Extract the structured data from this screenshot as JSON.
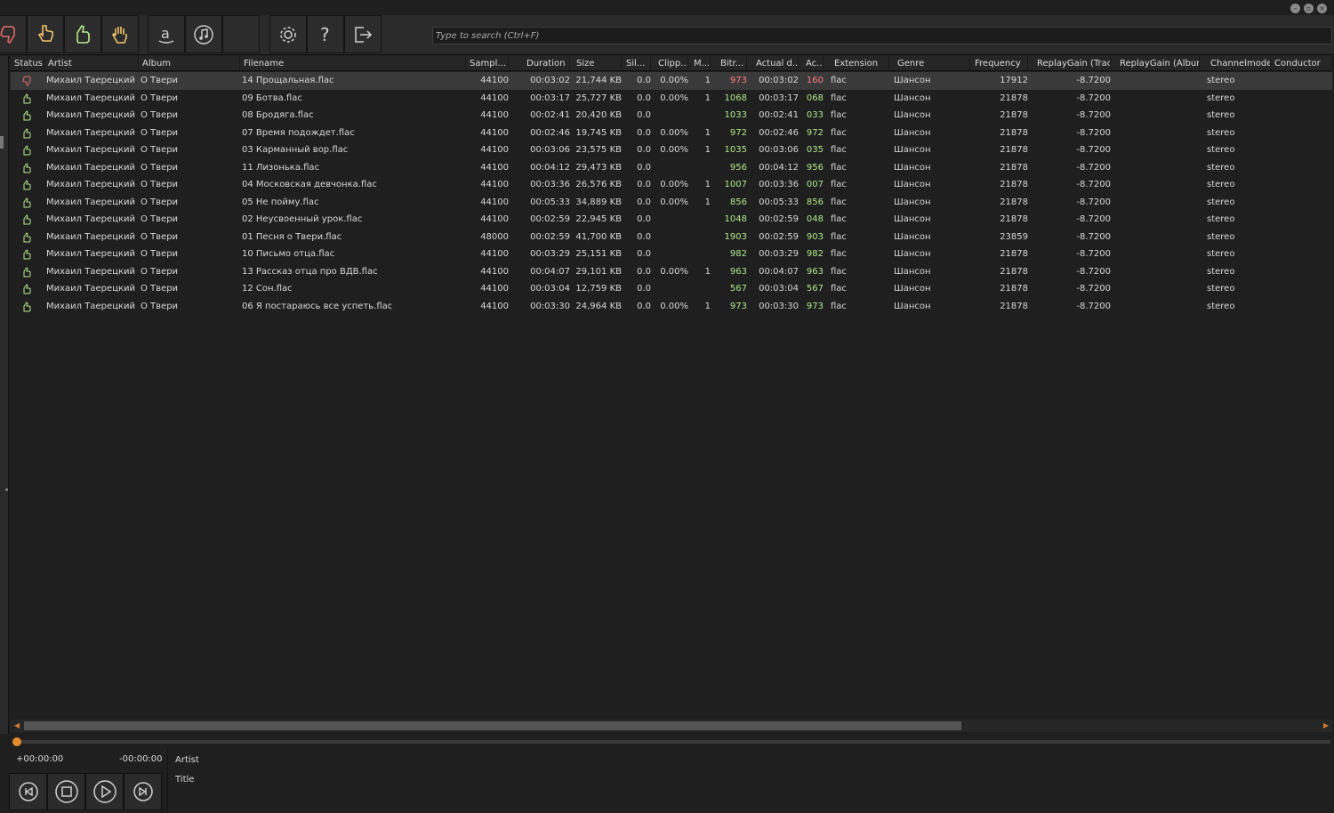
{
  "window": {
    "controls": [
      "minimize",
      "restore",
      "close"
    ]
  },
  "toolbar": {
    "groups": [
      [
        {
          "name": "thumbs-down-icon",
          "color": "#e26a6a"
        },
        {
          "name": "pointing-hand-icon",
          "color": "#f0c36a"
        },
        {
          "name": "thumbs-up-icon",
          "color": "#b8ea8e"
        },
        {
          "name": "raised-hand-icon",
          "color": "#f0c36a"
        }
      ],
      [
        {
          "name": "amazon-icon",
          "color": "#d0d0d0"
        },
        {
          "name": "music-note-icon",
          "color": "#d0d0d0"
        },
        {
          "name": "blank-icon",
          "color": "#d0d0d0"
        }
      ],
      [
        {
          "name": "gear-icon",
          "color": "#d0d0d0"
        },
        {
          "name": "help-icon",
          "color": "#d0d0d0"
        },
        {
          "name": "exit-icon",
          "color": "#d0d0d0"
        }
      ]
    ],
    "search_placeholder": "Type to search (Ctrl+F)",
    "search_value": ""
  },
  "table": {
    "columns": [
      "Status",
      "Artist",
      "Album",
      "Filename",
      "Sampl...",
      "Duration",
      "Size",
      "Sil...",
      "Clipp...",
      "M...",
      "Bitr...",
      "Actual d...",
      "Ac...",
      "Extension",
      "Genre",
      "Frequency",
      "ReplayGain (Track)",
      "ReplayGain (Album)",
      "Channelmode",
      "Conductor"
    ],
    "sort_column": "Status",
    "rows": [
      {
        "status": "bad",
        "artist": "Михаил Таерецкий",
        "album": "О Твери",
        "filename": "14 Прощальная.flac",
        "sample": "44100",
        "duration": "00:03:02",
        "size": "21,744 KB",
        "silence": "0.0",
        "clipping": "0.00%",
        "m": "1",
        "bitrate": "973",
        "actual_duration": "00:03:02",
        "ac": "160",
        "ext": "flac",
        "genre": "Шансон",
        "freq": "17912",
        "rg_track": "-8.7200",
        "rg_album": "",
        "channel": "stereo",
        "conductor": "",
        "selected": true
      },
      {
        "status": "good",
        "artist": "Михаил Таерецкий",
        "album": "О Твери",
        "filename": "09 Ботва.flac",
        "sample": "44100",
        "duration": "00:03:17",
        "size": "25,727 KB",
        "silence": "0.0",
        "clipping": "0.00%",
        "m": "1",
        "bitrate": "1068",
        "actual_duration": "00:03:17",
        "ac": "068",
        "ext": "flac",
        "genre": "Шансон",
        "freq": "21878",
        "rg_track": "-8.7200",
        "rg_album": "",
        "channel": "stereo",
        "conductor": ""
      },
      {
        "status": "good",
        "artist": "Михаил Таерецкий",
        "album": "О Твери",
        "filename": "08 Бродяга.flac",
        "sample": "44100",
        "duration": "00:02:41",
        "size": "20,420 KB",
        "silence": "0.0",
        "clipping": "",
        "m": "",
        "bitrate": "1033",
        "actual_duration": "00:02:41",
        "ac": "033",
        "ext": "flac",
        "genre": "Шансон",
        "freq": "21878",
        "rg_track": "-8.7200",
        "rg_album": "",
        "channel": "stereo",
        "conductor": ""
      },
      {
        "status": "good",
        "artist": "Михаил Таерецкий",
        "album": "О Твери",
        "filename": "07 Время подождет.flac",
        "sample": "44100",
        "duration": "00:02:46",
        "size": "19,745 KB",
        "silence": "0.0",
        "clipping": "0.00%",
        "m": "1",
        "bitrate": "972",
        "actual_duration": "00:02:46",
        "ac": "972",
        "ext": "flac",
        "genre": "Шансон",
        "freq": "21878",
        "rg_track": "-8.7200",
        "rg_album": "",
        "channel": "stereo",
        "conductor": ""
      },
      {
        "status": "good",
        "artist": "Михаил Таерецкий",
        "album": "О Твери",
        "filename": "03 Карманный вор.flac",
        "sample": "44100",
        "duration": "00:03:06",
        "size": "23,575 KB",
        "silence": "0.0",
        "clipping": "0.00%",
        "m": "1",
        "bitrate": "1035",
        "actual_duration": "00:03:06",
        "ac": "035",
        "ext": "flac",
        "genre": "Шансон",
        "freq": "21878",
        "rg_track": "-8.7200",
        "rg_album": "",
        "channel": "stereo",
        "conductor": ""
      },
      {
        "status": "good",
        "artist": "Михаил Таерецкий",
        "album": "О Твери",
        "filename": "11 Лизонька.flac",
        "sample": "44100",
        "duration": "00:04:12",
        "size": "29,473 KB",
        "silence": "0.0",
        "clipping": "",
        "m": "",
        "bitrate": "956",
        "actual_duration": "00:04:12",
        "ac": "956",
        "ext": "flac",
        "genre": "Шансон",
        "freq": "21878",
        "rg_track": "-8.7200",
        "rg_album": "",
        "channel": "stereo",
        "conductor": ""
      },
      {
        "status": "good",
        "artist": "Михаил Таерецкий",
        "album": "О Твери",
        "filename": "04 Московская девчонка.flac",
        "sample": "44100",
        "duration": "00:03:36",
        "size": "26,576 KB",
        "silence": "0.0",
        "clipping": "0.00%",
        "m": "1",
        "bitrate": "1007",
        "actual_duration": "00:03:36",
        "ac": "007",
        "ext": "flac",
        "genre": "Шансон",
        "freq": "21878",
        "rg_track": "-8.7200",
        "rg_album": "",
        "channel": "stereo",
        "conductor": ""
      },
      {
        "status": "good",
        "artist": "Михаил Таерецкий",
        "album": "О Твери",
        "filename": "05 Не пойму.flac",
        "sample": "44100",
        "duration": "00:05:33",
        "size": "34,889 KB",
        "silence": "0.0",
        "clipping": "0.00%",
        "m": "1",
        "bitrate": "856",
        "actual_duration": "00:05:33",
        "ac": "856",
        "ext": "flac",
        "genre": "Шансон",
        "freq": "21878",
        "rg_track": "-8.7200",
        "rg_album": "",
        "channel": "stereo",
        "conductor": ""
      },
      {
        "status": "good",
        "artist": "Михаил Таерецкий",
        "album": "О Твери",
        "filename": "02 Неусвоенный урок.flac",
        "sample": "44100",
        "duration": "00:02:59",
        "size": "22,945 KB",
        "silence": "0.0",
        "clipping": "",
        "m": "",
        "bitrate": "1048",
        "actual_duration": "00:02:59",
        "ac": "048",
        "ext": "flac",
        "genre": "Шансон",
        "freq": "21878",
        "rg_track": "-8.7200",
        "rg_album": "",
        "channel": "stereo",
        "conductor": ""
      },
      {
        "status": "good",
        "artist": "Михаил Таерецкий",
        "album": "О Твери",
        "filename": "01 Песня о Твери.flac",
        "sample": "48000",
        "duration": "00:02:59",
        "size": "41,700 KB",
        "silence": "0.0",
        "clipping": "",
        "m": "",
        "bitrate": "1903",
        "actual_duration": "00:02:59",
        "ac": "903",
        "ext": "flac",
        "genre": "Шансон",
        "freq": "23859",
        "rg_track": "-8.7200",
        "rg_album": "",
        "channel": "stereo",
        "conductor": ""
      },
      {
        "status": "good",
        "artist": "Михаил Таерецкий",
        "album": "О Твери",
        "filename": "10 Письмо отца.flac",
        "sample": "44100",
        "duration": "00:03:29",
        "size": "25,151 KB",
        "silence": "0.0",
        "clipping": "",
        "m": "",
        "bitrate": "982",
        "actual_duration": "00:03:29",
        "ac": "982",
        "ext": "flac",
        "genre": "Шансон",
        "freq": "21878",
        "rg_track": "-8.7200",
        "rg_album": "",
        "channel": "stereo",
        "conductor": ""
      },
      {
        "status": "good",
        "artist": "Михаил Таерецкий",
        "album": "О Твери",
        "filename": "13 Рассказ отца про ВДВ.flac",
        "sample": "44100",
        "duration": "00:04:07",
        "size": "29,101 KB",
        "silence": "0.0",
        "clipping": "0.00%",
        "m": "1",
        "bitrate": "963",
        "actual_duration": "00:04:07",
        "ac": "963",
        "ext": "flac",
        "genre": "Шансон",
        "freq": "21878",
        "rg_track": "-8.7200",
        "rg_album": "",
        "channel": "stereo",
        "conductor": ""
      },
      {
        "status": "good",
        "artist": "Михаил Таерецкий",
        "album": "О Твери",
        "filename": "12 Сон.flac",
        "sample": "44100",
        "duration": "00:03:04",
        "size": "12,759 KB",
        "silence": "0.0",
        "clipping": "",
        "m": "",
        "bitrate": "567",
        "actual_duration": "00:03:04",
        "ac": "567",
        "ext": "flac",
        "genre": "Шансон",
        "freq": "21878",
        "rg_track": "-8.7200",
        "rg_album": "",
        "channel": "stereo",
        "conductor": ""
      },
      {
        "status": "good",
        "artist": "Михаил Таерецкий",
        "album": "О Твери",
        "filename": "06 Я постараюсь все успеть.flac",
        "sample": "44100",
        "duration": "00:03:30",
        "size": "24,964 KB",
        "silence": "0.0",
        "clipping": "0.00%",
        "m": "1",
        "bitrate": "973",
        "actual_duration": "00:03:30",
        "ac": "973",
        "ext": "flac",
        "genre": "Шансон",
        "freq": "21878",
        "rg_track": "-8.7200",
        "rg_album": "",
        "channel": "stereo",
        "conductor": ""
      }
    ]
  },
  "colors": {
    "bad": "#e26a6a",
    "good": "#b8ea8e",
    "bitrate_good": "#aee88a",
    "bitrate_bad": "#ff7d7d",
    "accent": "#e38a2d"
  },
  "player": {
    "elapsed": "+00:00:00",
    "remaining": "-00:00:00",
    "artist_label": "Artist",
    "title_label": "Title",
    "progress": 0,
    "buttons": [
      "previous-icon",
      "stop-icon",
      "play-icon",
      "next-icon"
    ]
  }
}
